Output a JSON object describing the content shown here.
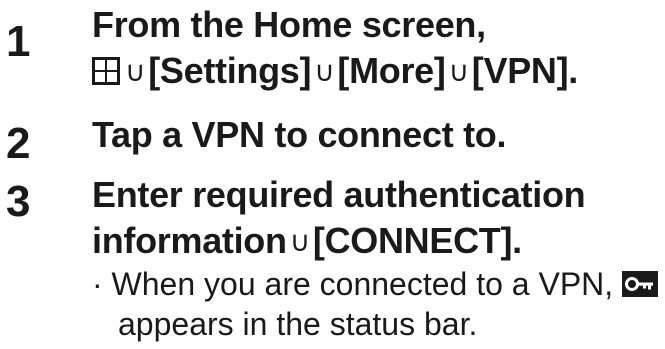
{
  "steps": [
    {
      "number": "1",
      "line1": "From the Home screen,",
      "path": [
        "[Settings]",
        "[More]",
        "[VPN]."
      ],
      "arrow": "∪",
      "icon": "apps-grid-icon"
    },
    {
      "number": "2",
      "text": "Tap a VPN to connect to."
    },
    {
      "number": "3",
      "line1": "Enter required authentication",
      "line2_text": "information",
      "line2_action": "[CONNECT].",
      "arrow": "∪"
    }
  ],
  "note": {
    "bullet": "·",
    "line1": "When you are connected to a VPN,",
    "line2": "appears in the status bar.",
    "icon": "vpn-key-icon"
  },
  "colors": {
    "text": "#1a1a1a",
    "icon_bg": "#1a1a1a",
    "icon_fg": "#ffffff"
  }
}
